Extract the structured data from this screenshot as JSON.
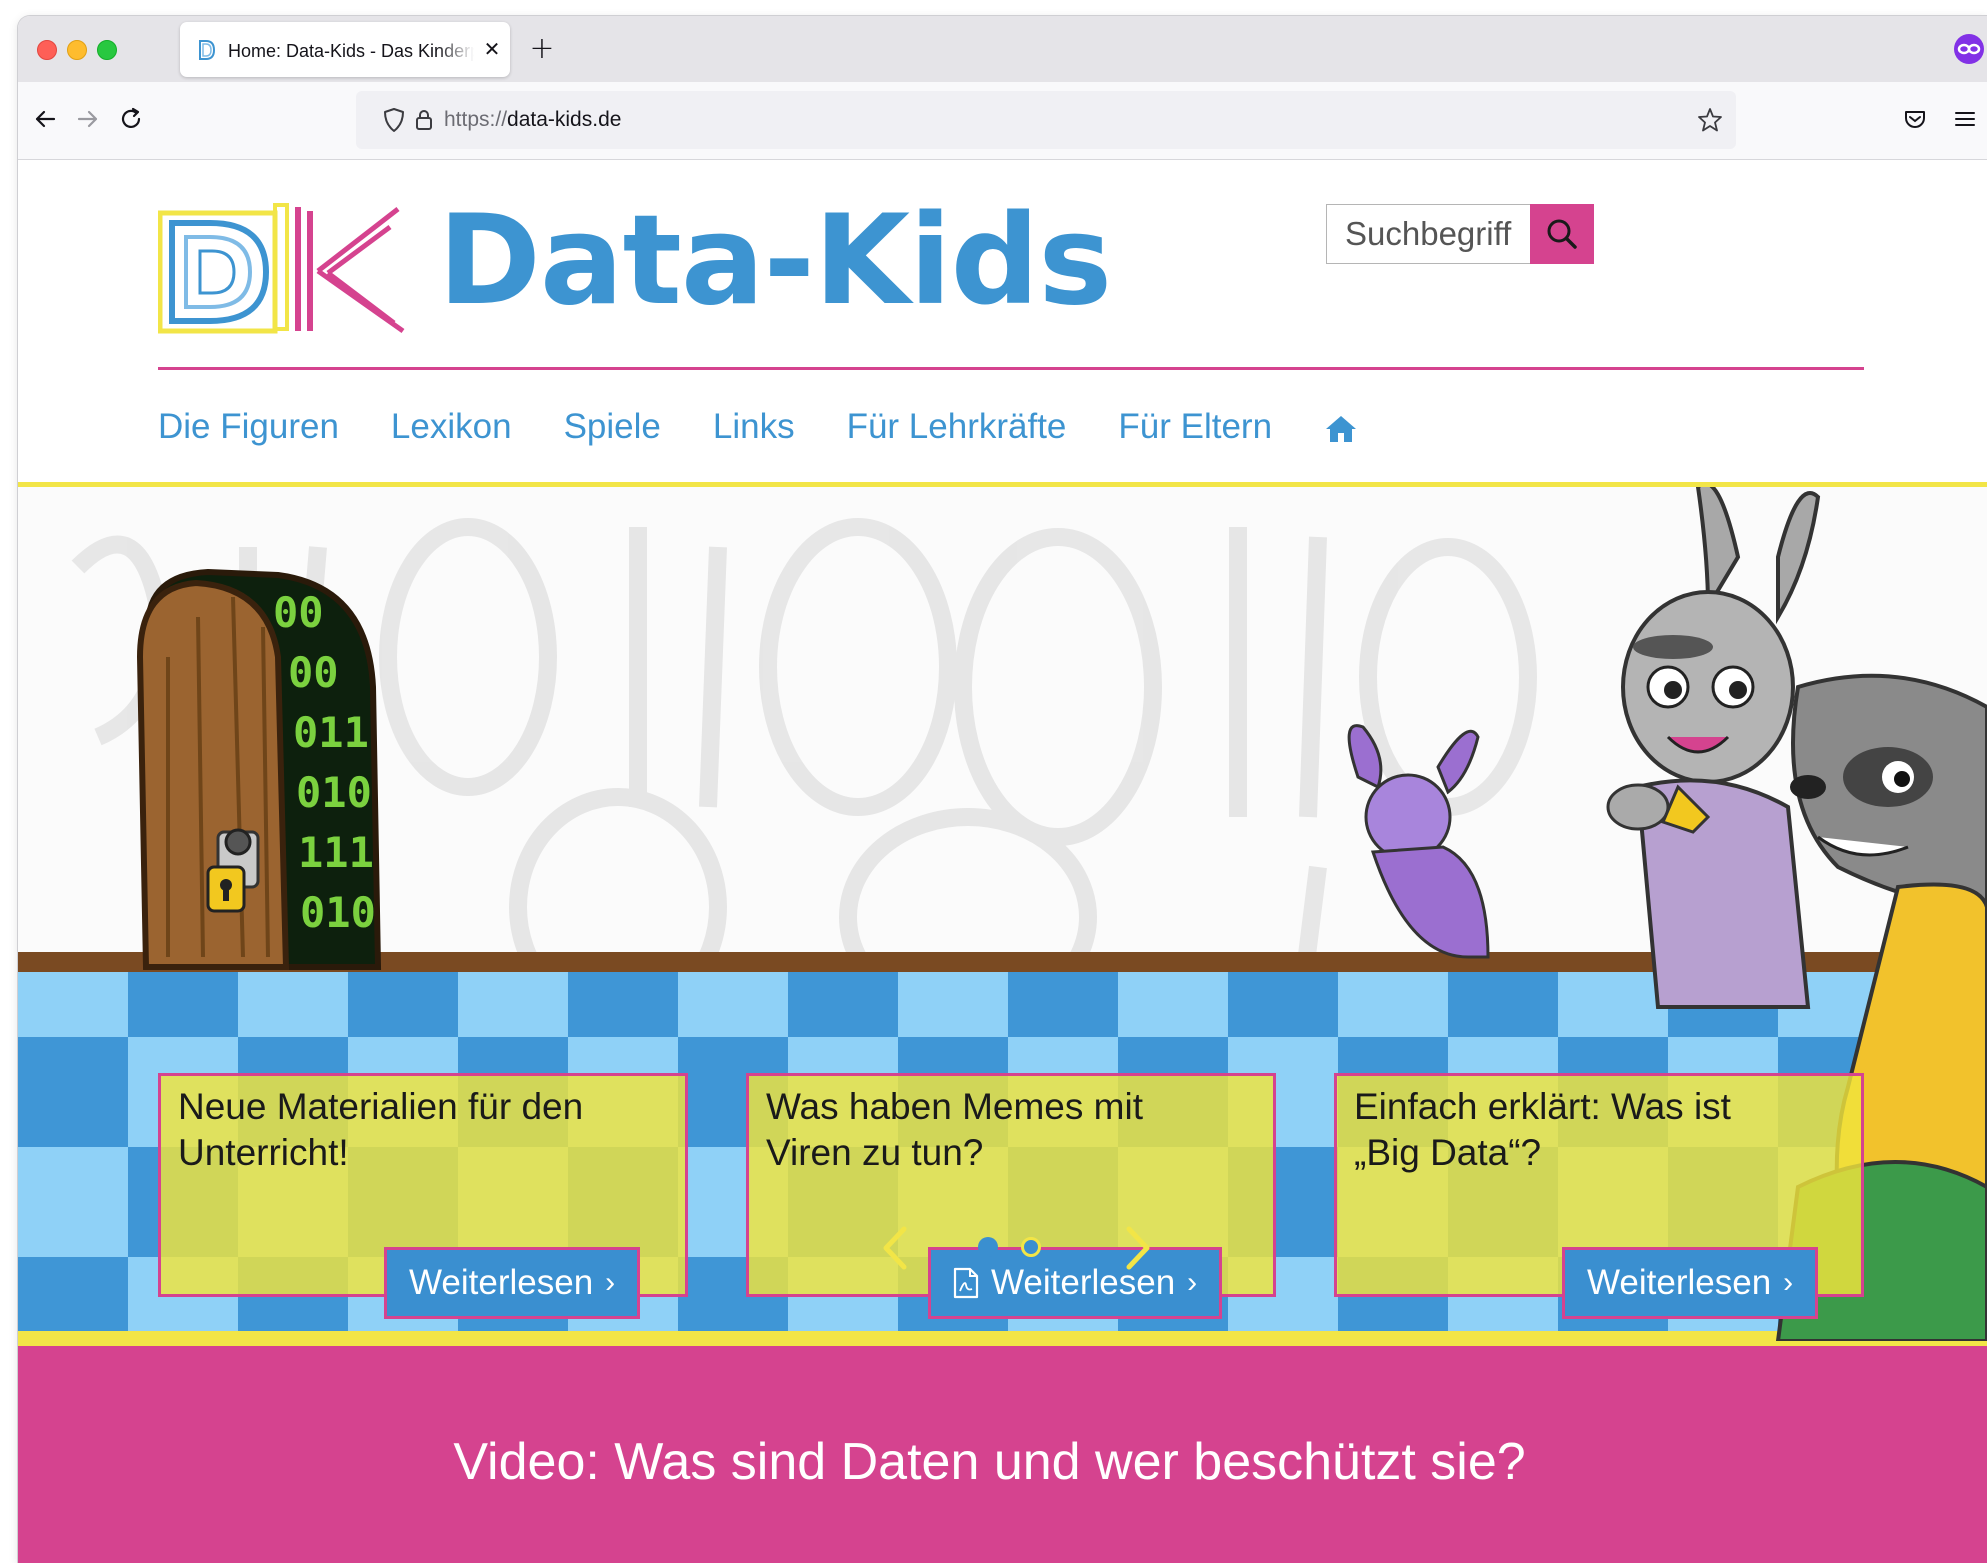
{
  "browser": {
    "tab_title": "Home: Data-Kids - Das Kinderportal",
    "url_scheme": "https://",
    "url_host": "data-kids.de"
  },
  "site": {
    "title": "Data-Kids",
    "search_placeholder": "Suchbegriff",
    "nav": [
      "Die Figuren",
      "Lexikon",
      "Spiele",
      "Links",
      "Für Lehrkräfte",
      "Für Eltern"
    ]
  },
  "hero": {
    "door_digits": [
      "00",
      "00",
      "011",
      "010",
      "111",
      "010"
    ],
    "cards": [
      {
        "title_line1": "Neue Materialien für den",
        "title_line2": "Unterricht!",
        "button": "Weiterlesen",
        "pdf_icon": false
      },
      {
        "title_line1": "Was haben Memes mit",
        "title_line2": "Viren zu tun?",
        "button": "Weiterlesen",
        "pdf_icon": true
      },
      {
        "title_line1": "Einfach erklärt: Was ist",
        "title_line2": "„Big Data“?",
        "button": "Weiterlesen",
        "pdf_icon": false
      }
    ],
    "slider_dots": 2,
    "active_dot": 1
  },
  "video": {
    "title": "Video: Was sind Daten und wer beschützt sie?"
  },
  "colors": {
    "brand_blue": "#3d94d1",
    "brand_pink": "#d5438f",
    "brand_yellow": "#f2e547"
  }
}
